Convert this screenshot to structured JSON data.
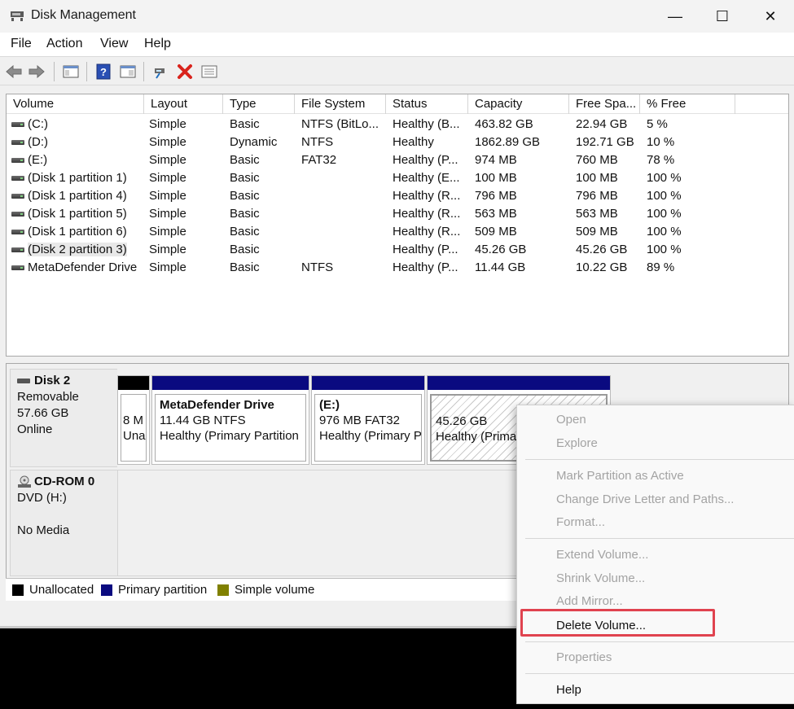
{
  "window": {
    "title": "Disk Management",
    "controls": {
      "minimize": "—",
      "maximize": "☐",
      "close": "✕"
    }
  },
  "menubar": {
    "items": [
      "File",
      "Action",
      "View",
      "Help"
    ]
  },
  "toolbar": {
    "icons": [
      "back-icon",
      "forward-icon",
      "console-tree-icon",
      "help-icon",
      "properties-icon",
      "connect-icon",
      "delete-icon",
      "list-icon"
    ]
  },
  "volume_list": {
    "columns": [
      "Volume",
      "Layout",
      "Type",
      "File System",
      "Status",
      "Capacity",
      "Free Spa...",
      "% Free"
    ],
    "rows": [
      [
        "(C:)",
        "Simple",
        "Basic",
        "NTFS (BitLo...",
        "Healthy (B...",
        "463.82 GB",
        "22.94 GB",
        "5 %"
      ],
      [
        "(D:)",
        "Simple",
        "Dynamic",
        "NTFS",
        "Healthy",
        "1862.89 GB",
        "192.71 GB",
        "10 %"
      ],
      [
        "(E:)",
        "Simple",
        "Basic",
        "FAT32",
        "Healthy (P...",
        "974 MB",
        "760 MB",
        "78 %"
      ],
      [
        "(Disk 1 partition 1)",
        "Simple",
        "Basic",
        "",
        "Healthy (E...",
        "100 MB",
        "100 MB",
        "100 %"
      ],
      [
        "(Disk 1 partition 4)",
        "Simple",
        "Basic",
        "",
        "Healthy (R...",
        "796 MB",
        "796 MB",
        "100 %"
      ],
      [
        "(Disk 1 partition 5)",
        "Simple",
        "Basic",
        "",
        "Healthy (R...",
        "563 MB",
        "563 MB",
        "100 %"
      ],
      [
        "(Disk 1 partition 6)",
        "Simple",
        "Basic",
        "",
        "Healthy (R...",
        "509 MB",
        "509 MB",
        "100 %"
      ],
      [
        "(Disk 2 partition 3)",
        "Simple",
        "Basic",
        "",
        "Healthy (P...",
        "45.26 GB",
        "45.26 GB",
        "100 %"
      ],
      [
        "MetaDefender Drive",
        "Simple",
        "Basic",
        "NTFS",
        "Healthy (P...",
        "11.44 GB",
        "10.22 GB",
        "89 %"
      ]
    ]
  },
  "disks": [
    {
      "name": "Disk 2",
      "type": "Removable",
      "size": "57.66 GB",
      "status": "Online",
      "partitions": [
        {
          "title": "",
          "line1": "8 M",
          "line2": "Una",
          "bar": "#000000",
          "hatched": false
        },
        {
          "title": "MetaDefender Drive",
          "line1": "11.44 GB NTFS",
          "line2": "Healthy (Primary Partition",
          "bar": "#0a0a80",
          "hatched": false
        },
        {
          "title": "(E:)",
          "line1": "976 MB FAT32",
          "line2": "Healthy (Primary P",
          "bar": "#0a0a80",
          "hatched": false
        },
        {
          "title": "",
          "line1": "45.26 GB",
          "line2": "Healthy (Prima",
          "bar": "#0a0a80",
          "hatched": true
        }
      ]
    },
    {
      "name": "CD-ROM 0",
      "type": "DVD (H:)",
      "size": "",
      "status": "No Media"
    }
  ],
  "legend": [
    {
      "label": "Unallocated",
      "color": "#000000"
    },
    {
      "label": "Primary partition",
      "color": "#0a0a80"
    },
    {
      "label": "Simple volume",
      "color": "#808000"
    }
  ],
  "context_menu": {
    "items": [
      {
        "label": "Open",
        "enabled": false
      },
      {
        "label": "Explore",
        "enabled": false
      },
      {
        "label": "Mark Partition as Active",
        "enabled": false
      },
      {
        "label": "Change Drive Letter and Paths...",
        "enabled": false
      },
      {
        "label": "Format...",
        "enabled": false
      },
      {
        "label": "Extend Volume...",
        "enabled": false
      },
      {
        "label": "Shrink Volume...",
        "enabled": false
      },
      {
        "label": "Add Mirror...",
        "enabled": false
      },
      {
        "label": "Delete Volume...",
        "enabled": true
      },
      {
        "label": "Properties",
        "enabled": false
      },
      {
        "label": "Help",
        "enabled": true
      }
    ],
    "highlight_color": "#e0434f"
  }
}
